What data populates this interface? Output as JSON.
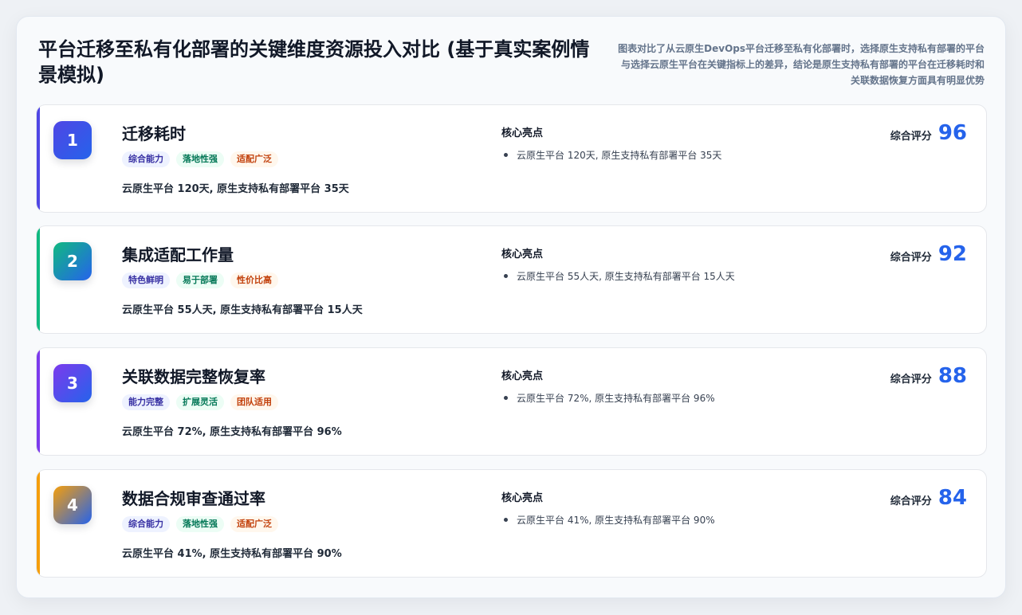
{
  "header": {
    "title": "平台迁移至私有化部署的关键维度资源投入对比 (基于真实案例情景模拟)",
    "description": "图表对比了从云原生DevOps平台迁移至私有化部署时，选择原生支持私有部署的平台与选择云原生平台在关键指标上的差异，结论是原生支持私有部署的平台在迁移耗时和关联数据恢复方面具有明显优势"
  },
  "highlight_label": "核心亮点",
  "score_label": "综合评分",
  "cards": [
    {
      "rank": "1",
      "title": "迁移耗时",
      "tags": [
        "综合能力",
        "落地性强",
        "适配广泛"
      ],
      "detail": "云原生平台 120天, 原生支持私有部署平台 35天",
      "highlight": "云原生平台 120天, 原生支持私有部署平台 35天",
      "score": "96",
      "accent": "#4f46e5"
    },
    {
      "rank": "2",
      "title": "集成适配工作量",
      "tags": [
        "特色鲜明",
        "易于部署",
        "性价比高"
      ],
      "detail": "云原生平台 55人天, 原生支持私有部署平台 15人天",
      "highlight": "云原生平台 55人天, 原生支持私有部署平台 15人天",
      "score": "92",
      "accent": "#10b981"
    },
    {
      "rank": "3",
      "title": "关联数据完整恢复率",
      "tags": [
        "能力完整",
        "扩展灵活",
        "团队适用"
      ],
      "detail": "云原生平台 72%, 原生支持私有部署平台 96%",
      "highlight": "云原生平台 72%, 原生支持私有部署平台 96%",
      "score": "88",
      "accent": "#7c3aed"
    },
    {
      "rank": "4",
      "title": "数据合规审查通过率",
      "tags": [
        "综合能力",
        "落地性强",
        "适配广泛"
      ],
      "detail": "云原生平台 41%, 原生支持私有部署平台 90%",
      "highlight": "云原生平台 41%, 原生支持私有部署平台 90%",
      "score": "84",
      "accent": "#f59e0b"
    }
  ]
}
